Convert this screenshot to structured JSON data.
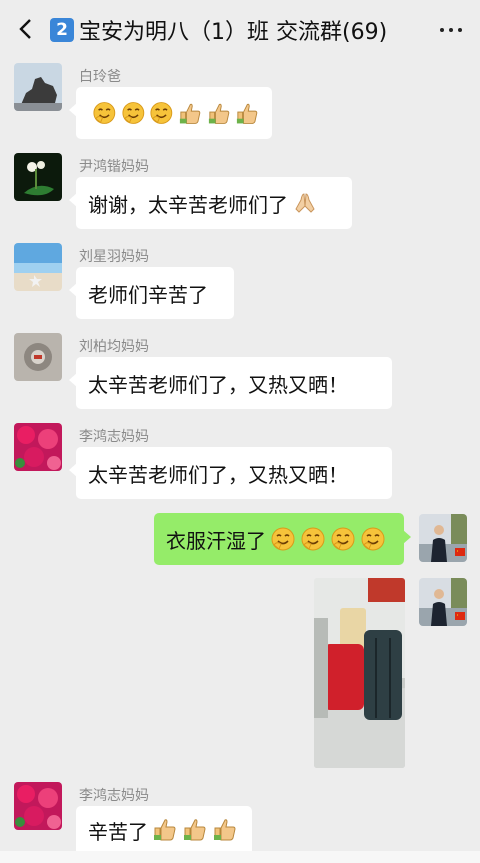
{
  "header": {
    "badge": "2",
    "title": "宝安为明八（1）班 交流群(69)",
    "back_icon": "chevron-left-icon",
    "more_icon": "ellipsis-icon"
  },
  "messages": [
    {
      "sender": "白玲爸",
      "text": "",
      "emojis": [
        "grin",
        "grin",
        "grin",
        "thumb",
        "thumb",
        "thumb"
      ]
    },
    {
      "sender": "尹鸿锴妈妈",
      "text": "谢谢，太辛苦老师们了",
      "emojis": [
        "pray"
      ]
    },
    {
      "sender": "刘星羽妈妈",
      "text": "老师们辛苦了",
      "emojis": []
    },
    {
      "sender": "刘柏均妈妈",
      "text": "太辛苦老师们了，又热又晒！",
      "emojis": []
    },
    {
      "sender": "李鸿志妈妈",
      "text": "太辛苦老师们了，又热又晒！",
      "emojis": []
    },
    {
      "sender": "",
      "text": "衣服汗湿了",
      "emojis": [
        "grin",
        "grin",
        "grin",
        "grin"
      ]
    },
    {
      "sender": "",
      "text": "",
      "emojis": []
    },
    {
      "sender": "李鸿志妈妈",
      "text": "辛苦了",
      "emojis": [
        "thumb",
        "thumb",
        "thumb"
      ]
    }
  ],
  "colors": {
    "bubble_self": "#95ec69",
    "bubble_other": "#ffffff",
    "background": "#ededed"
  }
}
